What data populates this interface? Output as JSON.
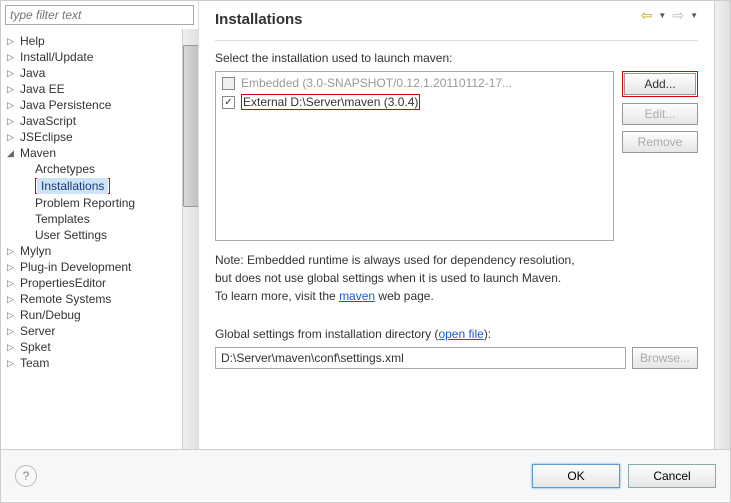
{
  "filter_placeholder": "type filter text",
  "tree": {
    "items": [
      {
        "label": "Help",
        "expanded": false,
        "hasChildren": true
      },
      {
        "label": "Install/Update",
        "expanded": false,
        "hasChildren": true
      },
      {
        "label": "Java",
        "expanded": false,
        "hasChildren": true
      },
      {
        "label": "Java EE",
        "expanded": false,
        "hasChildren": true
      },
      {
        "label": "Java Persistence",
        "expanded": false,
        "hasChildren": true
      },
      {
        "label": "JavaScript",
        "expanded": false,
        "hasChildren": true
      },
      {
        "label": "JSEclipse",
        "expanded": false,
        "hasChildren": true
      },
      {
        "label": "Maven",
        "expanded": true,
        "hasChildren": true,
        "children": [
          {
            "label": "Archetypes"
          },
          {
            "label": "Installations",
            "selected": true
          },
          {
            "label": "Problem Reporting"
          },
          {
            "label": "Templates"
          },
          {
            "label": "User Settings"
          }
        ]
      },
      {
        "label": "Mylyn",
        "expanded": false,
        "hasChildren": true
      },
      {
        "label": "Plug-in Development",
        "expanded": false,
        "hasChildren": true
      },
      {
        "label": "PropertiesEditor",
        "expanded": false,
        "hasChildren": true
      },
      {
        "label": "Remote Systems",
        "expanded": false,
        "hasChildren": true
      },
      {
        "label": "Run/Debug",
        "expanded": false,
        "hasChildren": true
      },
      {
        "label": "Server",
        "expanded": false,
        "hasChildren": true
      },
      {
        "label": "Spket",
        "expanded": false,
        "hasChildren": true
      },
      {
        "label": "Team",
        "expanded": false,
        "hasChildren": true
      }
    ]
  },
  "main": {
    "title": "Installations",
    "section_label": "Select the installation used to launch maven:",
    "installations": [
      {
        "label": "Embedded (3.0-SNAPSHOT/0.12.1.20110112-17...",
        "checked": false,
        "disabled": true
      },
      {
        "label": "External D:\\Server\\maven (3.0.4)",
        "checked": true,
        "disabled": false,
        "highlight": true
      }
    ],
    "buttons": {
      "add": "Add...",
      "edit": "Edit...",
      "remove": "Remove",
      "browse": "Browse..."
    },
    "note_line1": "Note: Embedded runtime is always used for dependency resolution,",
    "note_line2": "but does not use global settings when it is used to launch Maven.",
    "note_line3_prefix": "To learn more, visit the ",
    "note_link": "maven",
    "note_line3_suffix": " web page.",
    "global_label_prefix": "Global settings from installation directory (",
    "global_link": "open file",
    "global_label_suffix": "):",
    "global_path": "D:\\Server\\maven\\conf\\settings.xml"
  },
  "footer": {
    "ok": "OK",
    "cancel": "Cancel"
  }
}
